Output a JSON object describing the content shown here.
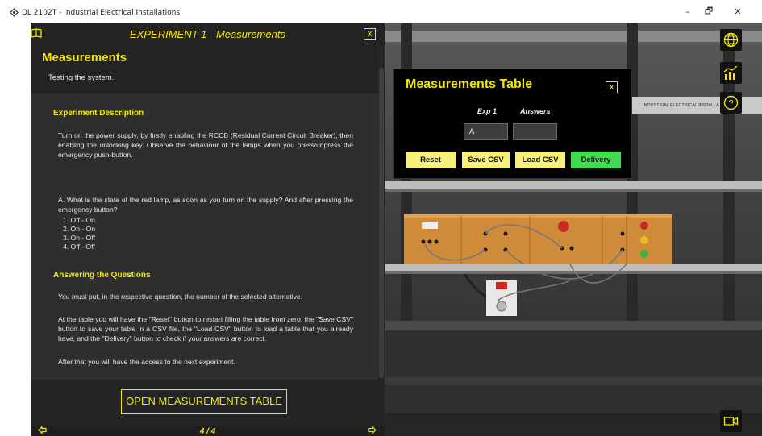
{
  "window": {
    "title": "DL 2102T - Industrial Electrical Installations",
    "minimize": "–",
    "maximize": "🗗",
    "close": "✕"
  },
  "panel": {
    "experiment_title": "EXPERIMENT 1 - Measurements",
    "close_label": "x",
    "section_title": "Measurements",
    "section_subtitle": "Testing the system.",
    "experiment_description": {
      "heading": "Experiment Description",
      "text": "Turn on the power supply, by firstly enabling the RCCB (Residual Current Circuit Breaker), then enabling the unlocking key. Observe the behaviour of the lamps when you press/unpress the emergency push-button."
    },
    "question": {
      "text": "A. What is the state of the red lamp, as soon as you turn on the supply? And after pressing the emergency button?",
      "options": [
        "1. Off - On",
        "2. On - On",
        "3. On - Off",
        "4. Off - Off"
      ]
    },
    "answering": {
      "heading": "Answering the Questions",
      "p1": "You must put, in the respective question, the number of the selected alternative.",
      "p2": "At the table you will have the \"Reset\" button to restart filling the table from zero, the \"Save CSV\" button to save your table in a CSV file, the \"Load CSV\" button to load a table that you already have, and the \"Delivery\" button to check if your answers are correct.",
      "p3": "After that you will have the access to the next experiment."
    },
    "open_button": "OPEN MEASUREMENTS TABLE",
    "page": "4 / 4"
  },
  "scene": {
    "board_label": "INDUSTRIAL ELECTRICAL INSTALLA"
  },
  "measurements_table": {
    "title": "Measurements Table",
    "close_label": "x",
    "columns": [
      "Exp 1",
      "Answers"
    ],
    "exp1_value": "A",
    "answers_value": "",
    "buttons": {
      "reset": "Reset",
      "save_csv": "Save CSV",
      "load_csv": "Load CSV",
      "delivery": "Delivery"
    },
    "colors": {
      "yellow_button": "#f7f07a",
      "delivery_button": "#3fdc50",
      "accent": "#f2e600"
    }
  },
  "side_icons": [
    "globe-icon",
    "chart-icon",
    "help-icon",
    "camera-icon"
  ]
}
